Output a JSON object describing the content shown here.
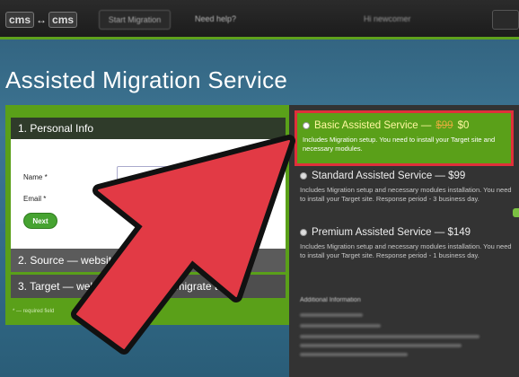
{
  "header": {
    "logo_left": "cms",
    "logo_right": "cms",
    "start_button": "Start Migration",
    "help_link": "Need help?",
    "user_label": "Hi newcomer"
  },
  "page": {
    "title": "Assisted Migration Service"
  },
  "wizard": {
    "step1_title": "1. Personal Info",
    "name_label": "Name *",
    "email_label": "Email *",
    "next_button": "Next",
    "step2_title": "2. Source — website you'd like to migrate from",
    "step3_title": "3. Target — website you'd like to migrate to",
    "required_note": "* — required field"
  },
  "plans": {
    "basic": {
      "title": "Basic Assisted Service —",
      "old_price": "$99",
      "price": "$0",
      "description": "Includes Migration setup. You need to install your Target site and necessary modules.",
      "selected": true
    },
    "standard": {
      "title": "Standard Assisted Service — $99",
      "description": "Includes Migration setup and necessary modules installation. You need to install your Target site. Response period - 3 business day."
    },
    "premium": {
      "title": "Premium Assisted Service — $149",
      "description": "Includes Migration setup and necessary modules installation. You need to install your Target site. Response period - 1 business day."
    },
    "additional_info": "Additional Information"
  },
  "colors": {
    "accent_green": "#5aa019",
    "highlight_red": "#e0303a",
    "arrow_red": "#e23a45",
    "dark_panel": "#333333"
  }
}
